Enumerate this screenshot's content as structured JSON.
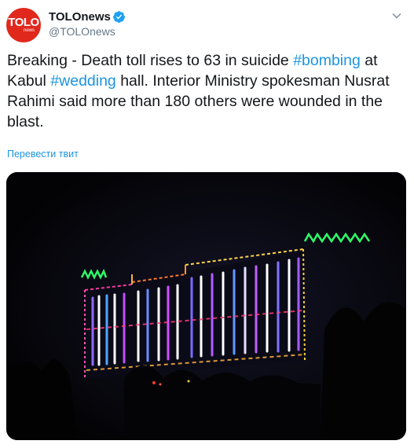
{
  "author": {
    "name": "TOLOnews",
    "handle": "@TOLOnews",
    "verified": true,
    "avatar_text": "TOLO",
    "avatar_subtext": "news"
  },
  "tweet": {
    "text_parts": [
      {
        "text": "Breaking - Death toll rises to 63 in suicide ",
        "hashtag": false
      },
      {
        "text": "#bombing",
        "hashtag": true
      },
      {
        "text": " at Kabul ",
        "hashtag": false
      },
      {
        "text": "#wedding",
        "hashtag": true
      },
      {
        "text": " hall. Interior Ministry spokesman Nusrat Rahimi said more than 180 others were wounded in the blast.",
        "hashtag": false
      }
    ]
  },
  "translate_label": "Перевести твит",
  "colors": {
    "link": "#1b95e0",
    "avatar_brand": "#e0281c",
    "verified": "#1da1f2",
    "handle": "#657786"
  },
  "icons": {
    "verified": "verified-badge-icon",
    "menu": "chevron-down-icon"
  }
}
